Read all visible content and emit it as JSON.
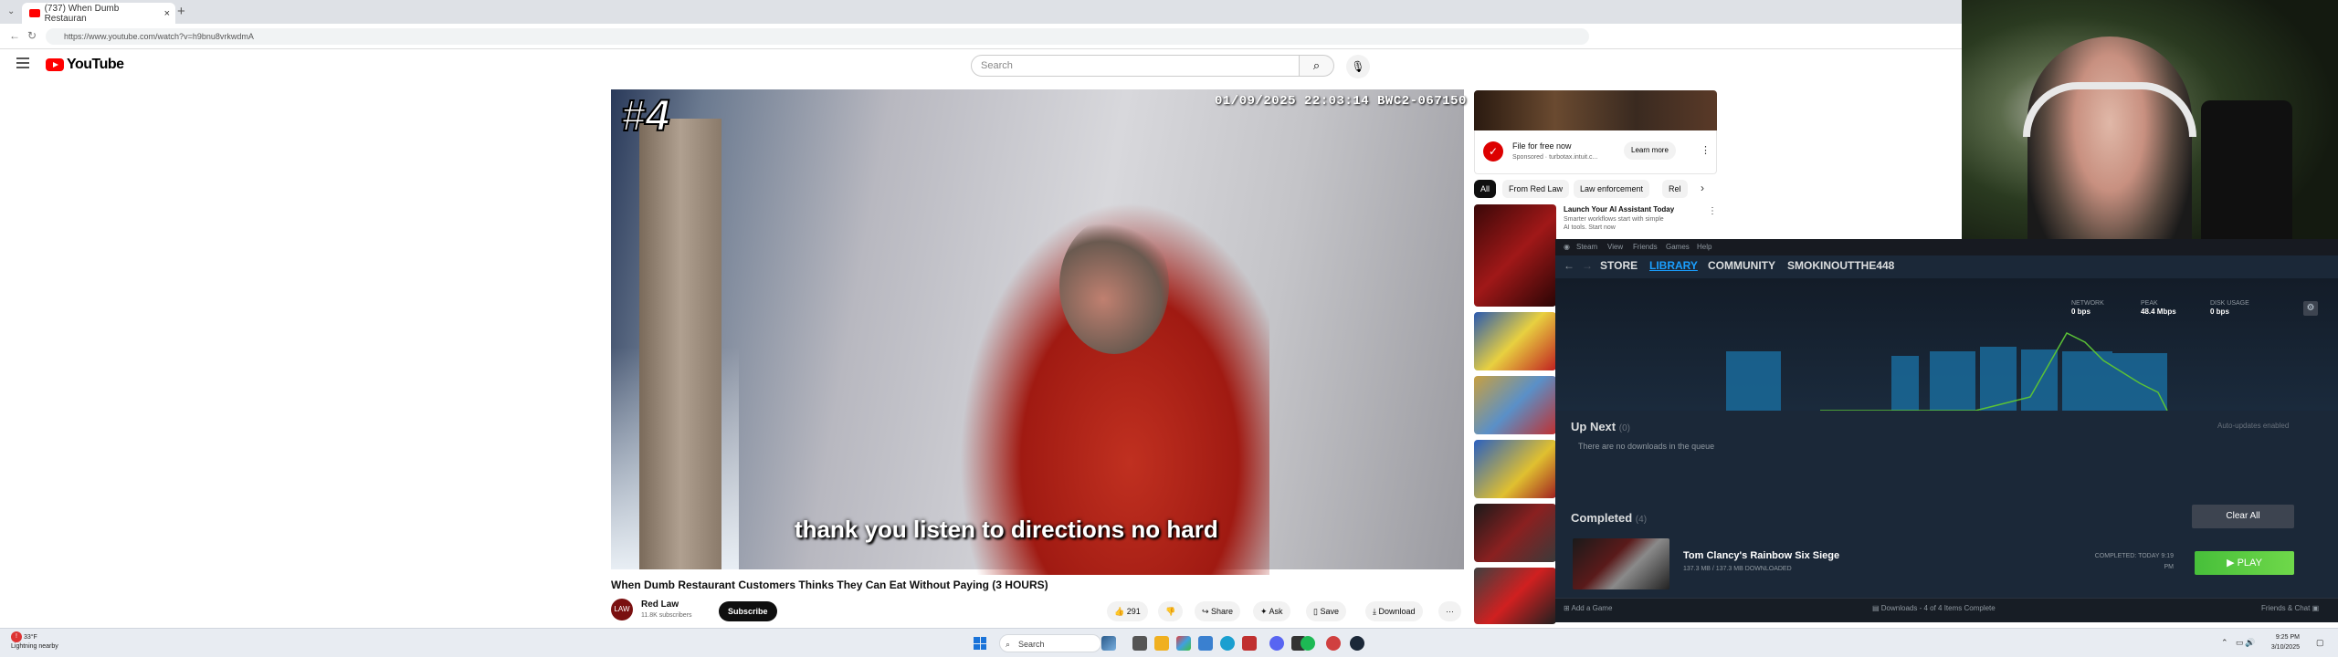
{
  "browser": {
    "tab_title": "(737) When Dumb Restauran",
    "url": "https://www.youtube.com/watch?v=h9bnu8vrkwdmA"
  },
  "youtube": {
    "logo_text": "YouTube",
    "search_placeholder": "Search",
    "video": {
      "overlay_number": "#4",
      "timestamp": "01/09/2025 22:03:14   BWC2-067150",
      "caption": "thank you listen to directions no hard",
      "title": "When Dumb Restaurant Customers Thinks They Can Eat Without Paying (3 HOURS)",
      "channel": "Red Law",
      "channel_avatar": "LAW",
      "subscribers": "11.8K subscribers",
      "subscribe_label": "Subscribe",
      "likes": "291",
      "share_label": "Share",
      "ask_label": "Ask",
      "save_label": "Save",
      "download_label": "Download",
      "more_label": "···"
    },
    "ad": {
      "title": "File for free now",
      "sponsor": "Sponsored · turbotax.intuit.c...",
      "button": "Learn more"
    },
    "chips": [
      "All",
      "From Red Law",
      "Law enforcement",
      "Rel"
    ],
    "suggestion": {
      "title": "Launch Your AI Assistant Today",
      "subtitle": "Smarter workflows start with simple AI tools. Start now"
    }
  },
  "steam": {
    "menu": [
      "Steam",
      "View",
      "Friends",
      "Games",
      "Help"
    ],
    "nav": [
      "STORE",
      "LIBRARY",
      "COMMUNITY",
      "SMOKINOUTTHE448"
    ],
    "stats": {
      "network_label": "NETWORK",
      "network_value": "0 bps",
      "peak_label": "PEAK",
      "peak_value": "48.4 Mbps",
      "disk_label": "DISK USAGE",
      "disk_value": "0 bps"
    },
    "up_next_label": "Up Next",
    "up_next_count": "(0)",
    "no_downloads": "There are no downloads in the queue",
    "auto_updates": "Auto-updates enabled",
    "completed_label": "Completed",
    "completed_count": "(4)",
    "clear_all": "Clear All",
    "game": {
      "name": "Tom Clancy's Rainbow Six Siege",
      "size": "137.3 MB / 137.3 MB DOWNLOADED",
      "completed_line1": "COMPLETED: TODAY 9:19",
      "completed_line2": "PM",
      "play": "▶ PLAY"
    },
    "footer": {
      "add_game": "Add a Game",
      "downloads": "Downloads - 4 of 4 Items Complete",
      "friends": "Friends & Chat"
    }
  },
  "taskbar": {
    "weather_temp": "33°F",
    "weather_desc": "Lightning nearby",
    "search": "Search",
    "time": "9:25 PM",
    "date": "3/10/2025"
  }
}
